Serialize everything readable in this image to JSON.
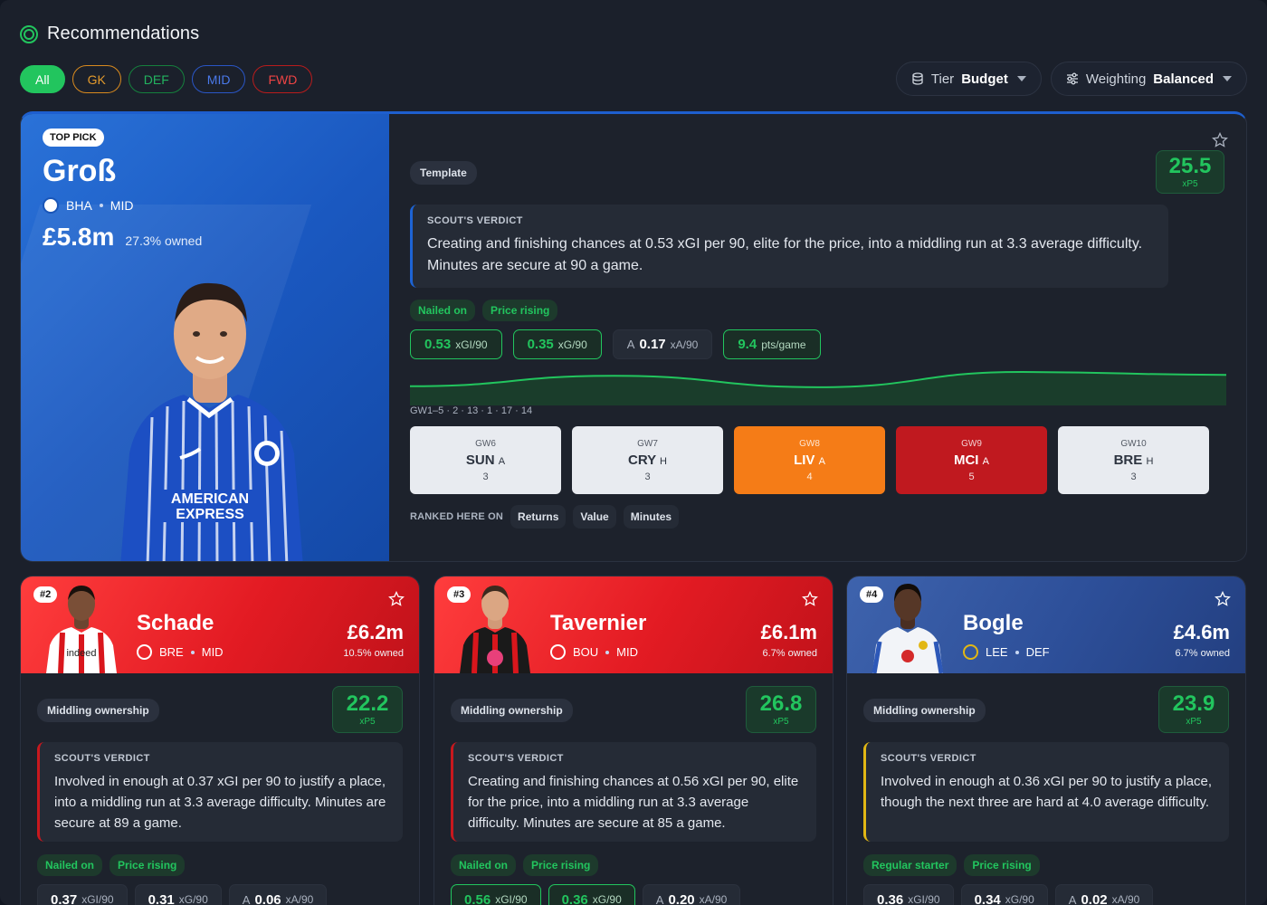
{
  "header": {
    "title": "Recommendations",
    "icon": "target-icon"
  },
  "filters": [
    "All",
    "GK",
    "DEF",
    "MID",
    "FWD"
  ],
  "controls": {
    "tier": {
      "label": "Tier",
      "value": "Budget"
    },
    "weighting": {
      "label": "Weighting",
      "value": "Balanced"
    }
  },
  "top_pick": {
    "badge": "TOP PICK",
    "name": "Groß",
    "club": "BHA",
    "position": "MID",
    "price": "£5.8m",
    "owned": "27.3% owned",
    "tag": "Template",
    "xp_value": "25.5",
    "xp_unit": "xP5",
    "verdict_heading": "SCOUT'S VERDICT",
    "verdict_text": "Creating and finishing chances at 0.53 xGI per 90, elite for the price, into a middling run at 3.3 average difficulty. Minutes are secure at 90 a game.",
    "tags": [
      "Nailed on",
      "Price rising"
    ],
    "stats": [
      {
        "prefix": "",
        "value": "0.53",
        "label": "xGI/90"
      },
      {
        "prefix": "",
        "value": "0.35",
        "label": "xG/90"
      },
      {
        "prefix": "A",
        "value": "0.17",
        "label": "xA/90"
      },
      {
        "prefix": "",
        "value": "9.4",
        "label": "pts/game"
      }
    ],
    "form_label": "GW1–5 · 2 · 13 · 1 · 17 · 14",
    "form_points": [
      2,
      13,
      1,
      17,
      14
    ],
    "fixtures": [
      {
        "gw": "GW6",
        "team": "SUN",
        "venue": "A",
        "difficulty": "3"
      },
      {
        "gw": "GW7",
        "team": "CRY",
        "venue": "H",
        "difficulty": "3"
      },
      {
        "gw": "GW8",
        "team": "LIV",
        "venue": "A",
        "difficulty": "4"
      },
      {
        "gw": "GW9",
        "team": "MCI",
        "venue": "A",
        "difficulty": "5"
      },
      {
        "gw": "GW10",
        "team": "BRE",
        "venue": "H",
        "difficulty": "3"
      }
    ],
    "ranked_label": "RANKED HERE ON",
    "ranked": [
      "Returns",
      "Value",
      "Minutes"
    ]
  },
  "cards": [
    {
      "rank": "#2",
      "name": "Schade",
      "club": "BRE",
      "position": "MID",
      "price": "£6.2m",
      "owned": "10.5% owned",
      "tag": "Middling ownership",
      "xp_value": "22.2",
      "xp_unit": "xP5",
      "verdict_heading": "SCOUT'S VERDICT",
      "verdict_text": "Involved in enough at 0.37 xGI per 90 to justify a place, into a middling run at 3.3 average difficulty. Minutes are secure at 89 a game.",
      "tags": [
        "Nailed on",
        "Price rising"
      ],
      "stats": [
        {
          "prefix": "",
          "value": "0.37",
          "label": "xGI/90"
        },
        {
          "prefix": "",
          "value": "0.31",
          "label": "xG/90"
        },
        {
          "prefix": "A",
          "value": "0.06",
          "label": "xA/90"
        }
      ]
    },
    {
      "rank": "#3",
      "name": "Tavernier",
      "club": "BOU",
      "position": "MID",
      "price": "£6.1m",
      "owned": "6.7% owned",
      "tag": "Middling ownership",
      "xp_value": "26.8",
      "xp_unit": "xP5",
      "verdict_heading": "SCOUT'S VERDICT",
      "verdict_text": "Creating and finishing chances at 0.56 xGI per 90, elite for the price, into a middling run at 3.3 average difficulty. Minutes are secure at 85 a game.",
      "tags": [
        "Nailed on",
        "Price rising"
      ],
      "stats": [
        {
          "prefix": "",
          "value": "0.56",
          "label": "xGI/90"
        },
        {
          "prefix": "",
          "value": "0.36",
          "label": "xG/90"
        },
        {
          "prefix": "A",
          "value": "0.20",
          "label": "xA/90"
        }
      ]
    },
    {
      "rank": "#4",
      "name": "Bogle",
      "club": "LEE",
      "position": "DEF",
      "price": "£4.6m",
      "owned": "6.7% owned",
      "tag": "Middling ownership",
      "xp_value": "23.9",
      "xp_unit": "xP5",
      "verdict_heading": "SCOUT'S VERDICT",
      "verdict_text": "Involved in enough at 0.36 xGI per 90 to justify a place, though the next three are hard at 4.0 average difficulty.",
      "tags": [
        "Regular starter",
        "Price rising"
      ],
      "stats": [
        {
          "prefix": "",
          "value": "0.36",
          "label": "xGI/90"
        },
        {
          "prefix": "",
          "value": "0.34",
          "label": "xG/90"
        },
        {
          "prefix": "A",
          "value": "0.02",
          "label": "xA/90"
        }
      ]
    }
  ],
  "colors": {
    "accent": "#22c55e",
    "bha_blue": "#1a58c0",
    "red": "#e31b23",
    "lee_blue": "#2d4f99"
  }
}
